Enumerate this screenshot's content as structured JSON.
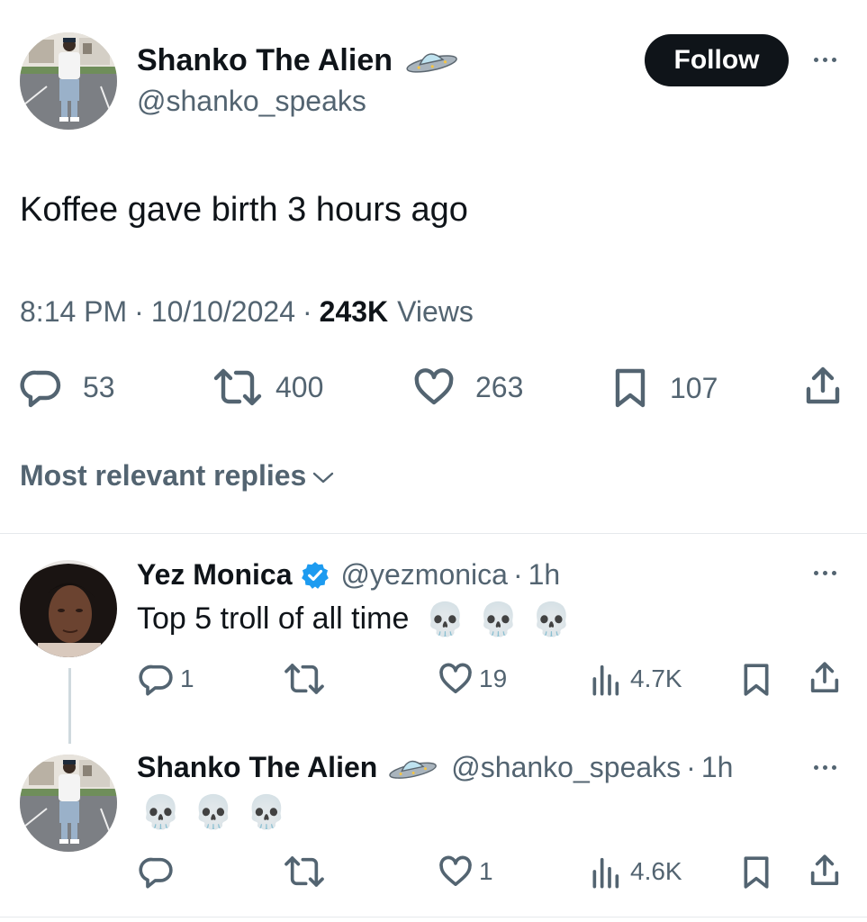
{
  "tweet": {
    "author_name": "Shanko The Alien",
    "author_handle": "@shanko_speaks",
    "follow_label": "Follow",
    "text": "Koffee gave birth 3 hours ago",
    "time": "8:14 PM",
    "date": "10/10/2024",
    "views_count": "243K",
    "views_label": "Views",
    "replies": "53",
    "reposts": "400",
    "likes": "263",
    "bookmarks": "107"
  },
  "replies_header": {
    "label": "Most relevant replies"
  },
  "replies": [
    {
      "author_name": "Yez Monica",
      "verified": true,
      "handle": "@yezmonica",
      "age": "1h",
      "text": "Top 5 troll of all time",
      "emoji": [
        "💀",
        "💀",
        "💀"
      ],
      "replies": "1",
      "reposts": "",
      "likes": "19",
      "views": "4.7K"
    },
    {
      "author_name": "Shanko The Alien",
      "handle": "@shanko_speaks",
      "age": "1h",
      "emoji": [
        "💀",
        "💀",
        "💀"
      ],
      "replies": "",
      "reposts": "",
      "likes": "1",
      "views": "4.6K"
    }
  ],
  "colors": {
    "text": "#0f1419",
    "muted": "#536471",
    "verified": "#1d9bf0",
    "follow_bg": "#0f1419"
  },
  "icons": [
    "ufo-icon",
    "reply-icon",
    "repost-icon",
    "like-icon",
    "bookmark-icon",
    "share-icon",
    "views-icon",
    "more-icon",
    "verified-badge-icon"
  ]
}
